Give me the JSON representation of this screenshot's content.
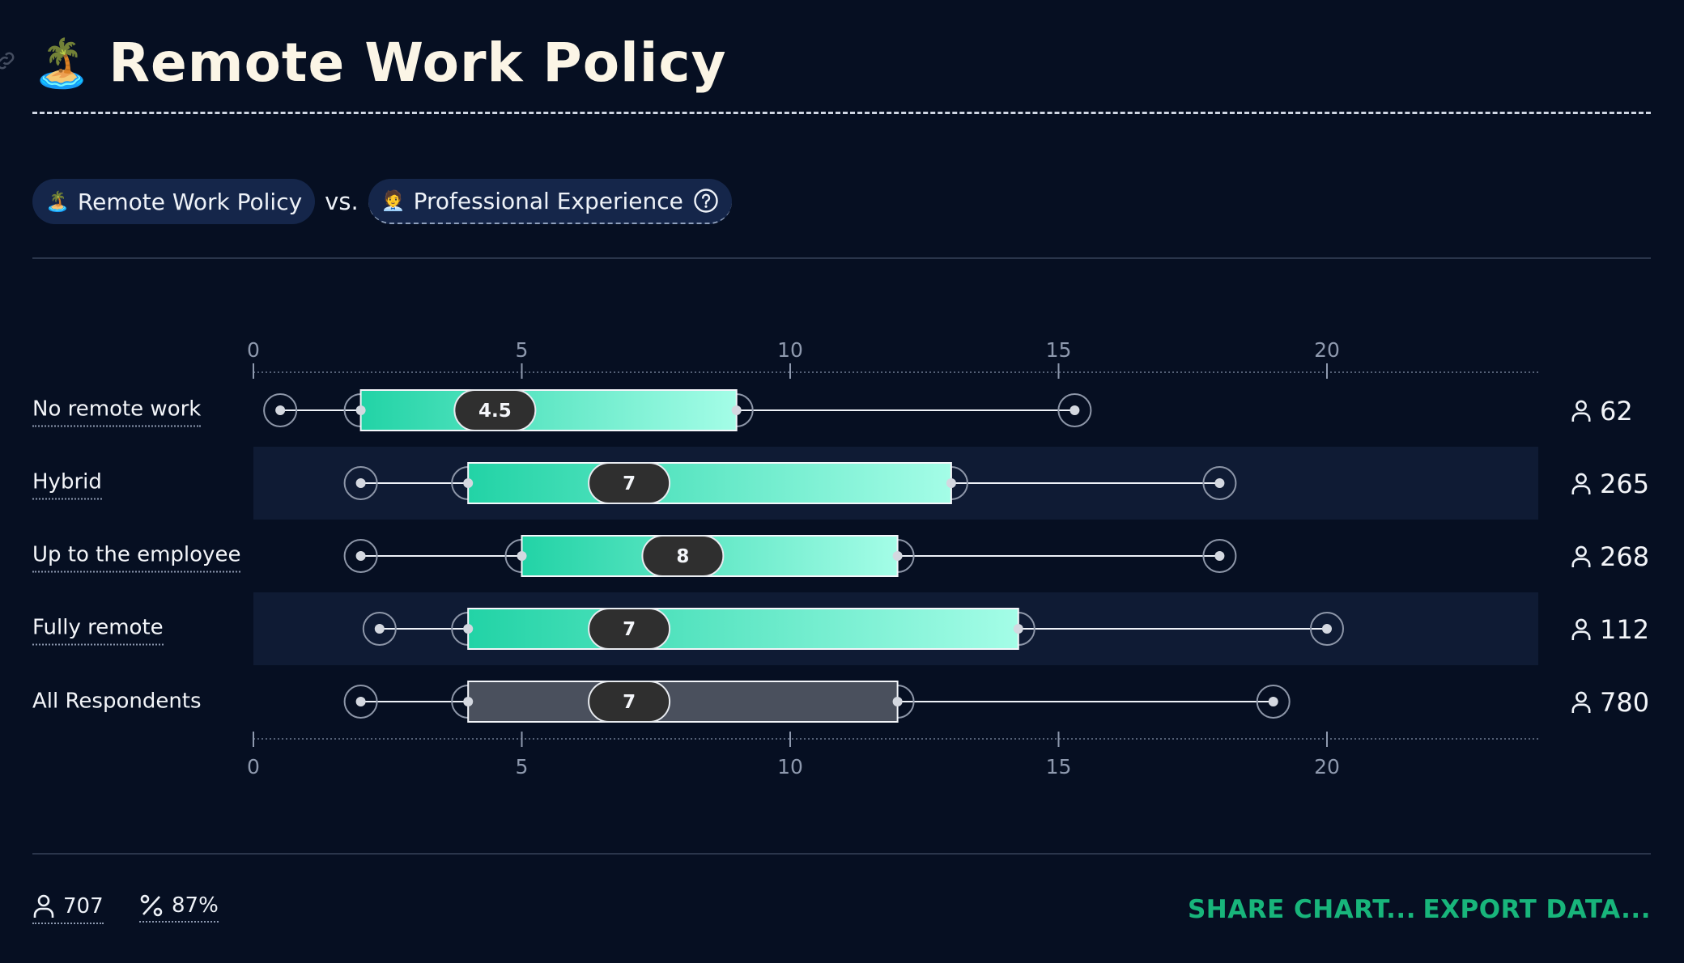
{
  "page": {
    "title_emoji": "🏝️",
    "title": "Remote Work Policy",
    "pill_a": {
      "emoji": "🏝️",
      "label": "Remote Work Policy"
    },
    "vs_label": "vs.",
    "pill_b": {
      "emoji": "🧑‍💼",
      "label": "Professional Experience"
    }
  },
  "chart_data": {
    "type": "boxplot",
    "x_ticks": [
      "0",
      "5",
      "10",
      "15",
      "20"
    ],
    "x_tick_values": [
      0,
      5,
      10,
      15,
      20
    ],
    "xlim": [
      0,
      24
    ],
    "rows": [
      {
        "label": "No remote work",
        "min": 0.5,
        "q1": 2,
        "median": 4.5,
        "median_label": "4.5",
        "q3": 9,
        "max": 15.3,
        "count": "62",
        "highlighted": false
      },
      {
        "label": "Hybrid",
        "min": 2,
        "q1": 4,
        "median": 7,
        "median_label": "7",
        "q3": 13,
        "max": 18,
        "count": "265",
        "highlighted": true
      },
      {
        "label": "Up to the employee",
        "min": 2,
        "q1": 5,
        "median": 8,
        "median_label": "8",
        "q3": 12,
        "max": 18,
        "count": "268",
        "highlighted": false
      },
      {
        "label": "Fully remote",
        "min": 2.35,
        "q1": 4,
        "median": 7,
        "median_label": "7",
        "q3": 14.25,
        "max": 20,
        "count": "112",
        "highlighted": true
      },
      {
        "label": "All Respondents",
        "min": 2,
        "q1": 4,
        "median": 7,
        "median_label": "7",
        "q3": 12,
        "max": 19,
        "count": "780",
        "highlighted": false,
        "aggregate": true
      }
    ],
    "colors": {
      "box_start": "#22d3a6",
      "box_end": "#a4fde7",
      "aggregate_box": "#4a505d",
      "row_highlight": "#0f1b34",
      "median_pill": "#2f2f2f"
    }
  },
  "footer": {
    "respondents": "707",
    "percent": "87%",
    "share_label": "SHARE CHART...",
    "export_label": "EXPORT DATA..."
  }
}
